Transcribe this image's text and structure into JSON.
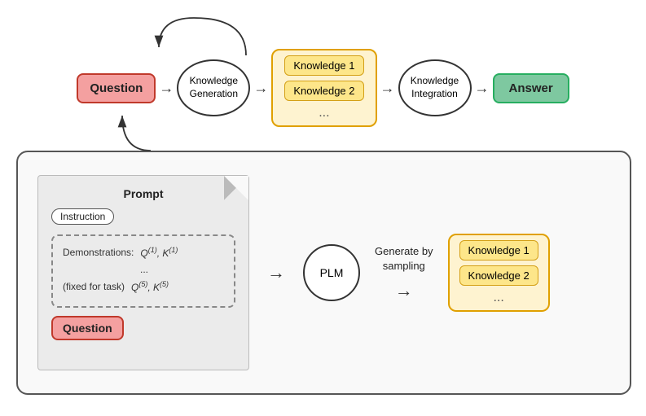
{
  "top": {
    "question_label": "Question",
    "knowledge_gen_label": "Knowledge\nGeneration",
    "knowledge_int_label": "Knowledge\nIntegration",
    "answer_label": "Answer",
    "knowledge_items": [
      "Knowledge 1",
      "Knowledge 2"
    ],
    "knowledge_dots": "..."
  },
  "bottom": {
    "prompt_title": "Prompt",
    "instruction_label": "Instruction",
    "demonstrations_label": "Demonstrations:",
    "fixed_label": "(fixed for task)",
    "q1k1": "Q⁽¹⁾, K⁽¹⁾",
    "dots": "...",
    "q5k5": "Q⁽⁵⁾, K⁽⁵⁾",
    "question_label": "Question",
    "plm_label": "PLM",
    "generate_label": "Generate by\nsampling",
    "knowledge_items": [
      "Knowledge 1",
      "Knowledge 2"
    ],
    "knowledge_dots": "..."
  },
  "arrows": {
    "right": "→",
    "dots": "..."
  }
}
